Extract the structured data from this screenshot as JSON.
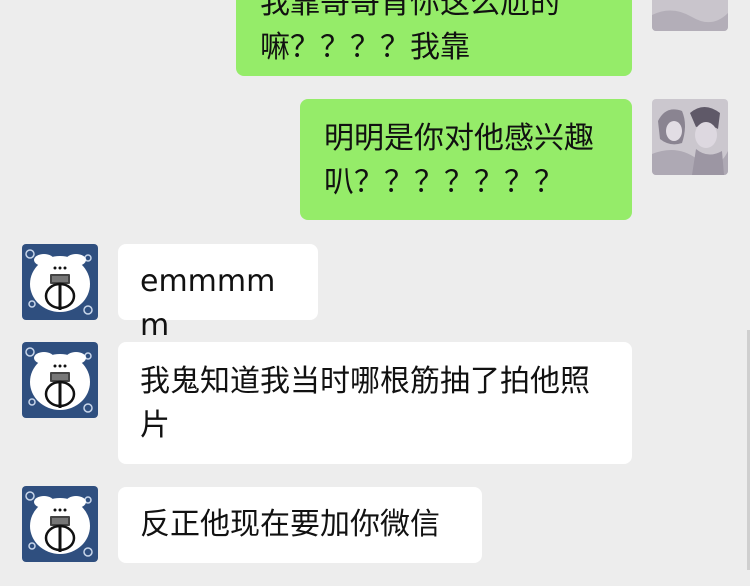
{
  "messages": [
    {
      "sender": "self",
      "text": "我靠哥哥肯你这么尬的嘛？？？？我靠"
    },
    {
      "sender": "self",
      "text": "明明是你对他感兴趣叭？？？？？？？"
    },
    {
      "sender": "other",
      "text": "emmmmm"
    },
    {
      "sender": "other",
      "text": "我鬼知道我当时哪根筋抽了拍他照片"
    },
    {
      "sender": "other",
      "text": "反正他现在要加你微信"
    }
  ],
  "avatars": {
    "self": "illustrated-couple-avatar",
    "other": "cartoon-character-avatar"
  },
  "colors": {
    "background": "#ededed",
    "self_bubble": "#95ec69",
    "other_bubble": "#ffffff"
  }
}
